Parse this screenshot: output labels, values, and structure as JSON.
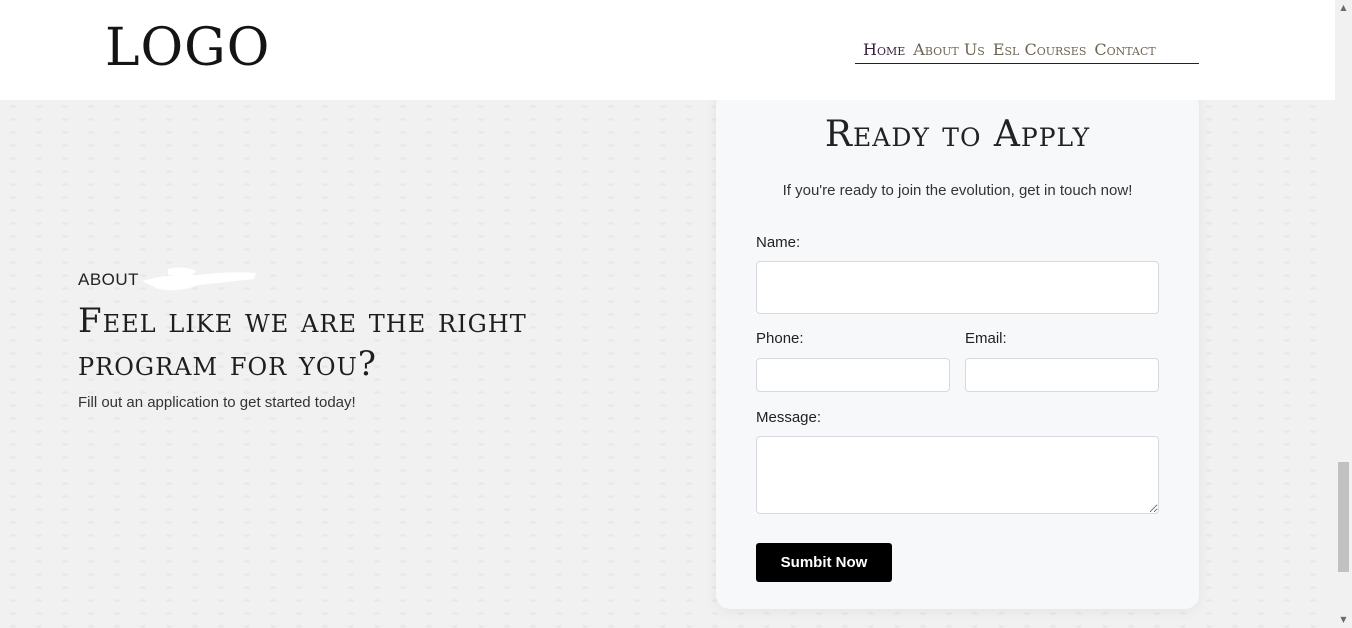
{
  "header": {
    "logo": "LOGO",
    "nav": [
      "Home",
      "About Us",
      "Esl Courses",
      "Contact"
    ]
  },
  "intro": {
    "eyebrow": "ABOUT",
    "headline": "Feel like we are the right program for you?",
    "subtext": "Fill out an application to get started today!"
  },
  "form": {
    "title": "Ready to Apply",
    "subtitle": "If you're ready to join the evolution, get in touch now!",
    "name_label": "Name:",
    "phone_label": "Phone:",
    "email_label": "Email:",
    "message_label": "Message:",
    "name_value": "",
    "phone_value": "",
    "email_value": "",
    "message_value": "",
    "submit_label": "Sumbit Now"
  },
  "colors": {
    "accent": "#000000",
    "nav_active": "#3a1f3c",
    "nav_text": "#6e6552",
    "background": "#f2f2f2",
    "card": "#f7f8fa"
  }
}
